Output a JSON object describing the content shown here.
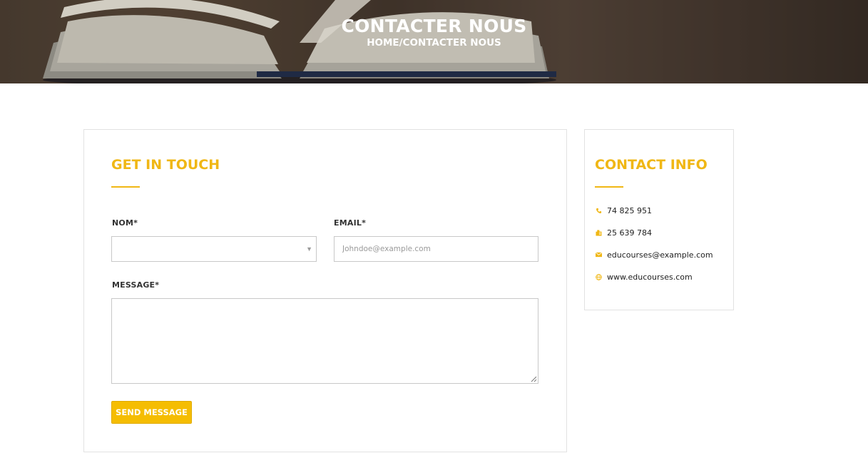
{
  "hero": {
    "title": "CONTACTER NOUS",
    "breadcrumb": "HOME/CONTACTER NOUS"
  },
  "form": {
    "title": "GET IN TOUCH",
    "name_label": "NOM*",
    "name_value": "",
    "email_label": "EMAIL*",
    "email_placeholder": "Johndoe@example.com",
    "message_label": "MESSAGE*",
    "message_value": "",
    "submit_label": "SEND MESSAGE"
  },
  "contact_info": {
    "title": "CONTACT INFO",
    "items": [
      {
        "icon": "phone-icon",
        "text": "74 825 951"
      },
      {
        "icon": "fax-icon",
        "text": "25 639 784"
      },
      {
        "icon": "envelope-icon",
        "text": "educourses@example.com"
      },
      {
        "icon": "globe-icon",
        "text": "www.educourses.com"
      }
    ]
  },
  "colors": {
    "accent": "#f0b715",
    "button": "#f5bd02",
    "border": "#e2e2e2"
  }
}
